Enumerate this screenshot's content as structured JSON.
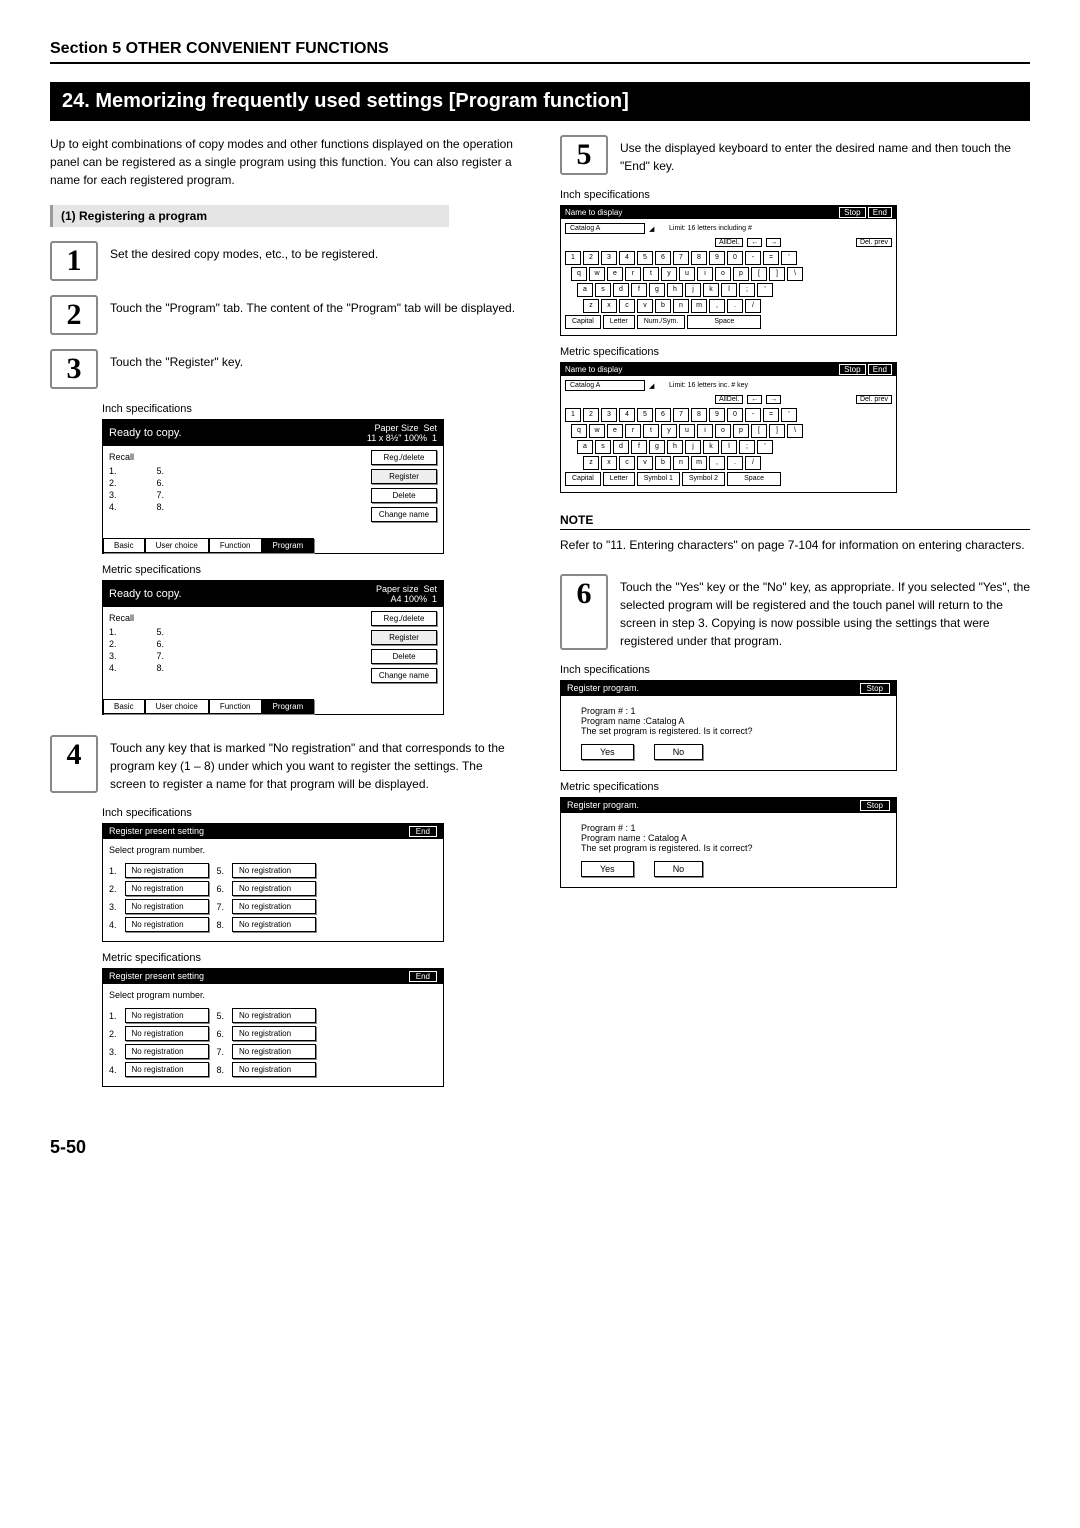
{
  "section_header": "Section 5  OTHER CONVENIENT FUNCTIONS",
  "title_bar": "24. Memorizing frequently used settings [Program function]",
  "intro": "Up to eight combinations of copy modes and other functions displayed on the operation panel can be registered as a single program using this function. You can also register a name for each registered program.",
  "sub1": "(1)  Registering a program",
  "step1": "Set the desired copy modes, etc., to be registered.",
  "step2": "Touch the \"Program\" tab. The content of the \"Program\" tab will be displayed.",
  "step3": "Touch the \"Register\" key.",
  "inch_label": "Inch specifications",
  "metric_label": "Metric specifications",
  "ready": "Ready to copy.",
  "paper_inch": "Paper Size",
  "paper_inch_val": "11 x 8½\"",
  "paper_metric": "Paper size",
  "paper_metric_val": "A4",
  "set_label": "Set",
  "count": "1",
  "recall": "Recall",
  "slots": [
    "1.",
    "2.",
    "3.",
    "4.",
    "5.",
    "6.",
    "7.",
    "8."
  ],
  "side_btns": {
    "regdel": "Reg./delete",
    "register": "Register",
    "delete": "Delete",
    "change": "Change name"
  },
  "tabs": {
    "basic": "Basic",
    "user": "User choice",
    "func": "Function",
    "program": "Program"
  },
  "step4": "Touch any key that is marked \"No registration\" and that corresponds to the program key (1 – 8) under which you want to register the settings. The screen to register a name for that program will be displayed.",
  "reg_title": "Register present setting",
  "end_btn": "End",
  "select_prog": "Select program number.",
  "noreg": "No registration",
  "step5": "Use the displayed keyboard to enter the desired name and then touch the \"End\" key.",
  "kbd_title": "Name to display",
  "stop_btn": "Stop",
  "catalog": "Catalog A",
  "limit_inch": "Limit: 16 letters including #",
  "limit_metric": "Limit: 16 letters inc. # key",
  "alldel": "AllDel.",
  "arrow_l": "←",
  "arrow_r": "→",
  "delprev": "Del. prev",
  "row_num": [
    "1",
    "2",
    "3",
    "4",
    "5",
    "6",
    "7",
    "8",
    "9",
    "0",
    "-",
    "=",
    "'"
  ],
  "row_q": [
    "q",
    "w",
    "e",
    "r",
    "t",
    "y",
    "u",
    "i",
    "o",
    "p",
    "[",
    "]",
    "\\"
  ],
  "row_a": [
    "a",
    "s",
    "d",
    "f",
    "g",
    "h",
    "j",
    "k",
    "l",
    ";",
    "'"
  ],
  "row_z": [
    "z",
    "x",
    "c",
    "v",
    "b",
    "n",
    "m",
    ",",
    ".",
    "/"
  ],
  "capital": "Capital",
  "letter": "Letter",
  "numsym": "Num./Sym.",
  "space": "Space",
  "symbol1": "Symbol 1",
  "symbol2": "Symbol 2",
  "note_head": "NOTE",
  "note_body": "Refer to \"11. Entering characters\" on page 7-104 for information on entering characters.",
  "step6": "Touch the \"Yes\" key or the \"No\" key, as appropriate. If you selected \"Yes\", the selected program will be registered and the touch panel will return to the screen in step 3. Copying is now possible using the settings that were registered under that program.",
  "confirm_title": "Register program.",
  "prog_num": "Program # : 1",
  "prog_name_inch": "Program name :Catalog A",
  "prog_name_metric": "Program name : Catalog  A",
  "confirm_q": "The set program is registered. Is it correct?",
  "yes": "Yes",
  "no": "No",
  "page_num": "5-50"
}
